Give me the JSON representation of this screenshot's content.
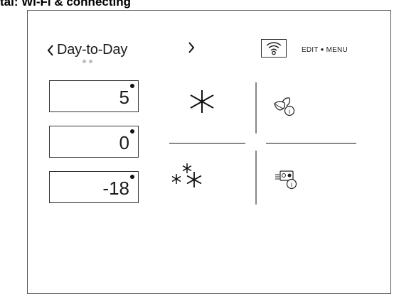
{
  "heading": "tal: Wi-Fi & connecting",
  "nav": {
    "prev_label": "Day-to-Day"
  },
  "header": {
    "edit_label": "EDIT",
    "menu_label": "MENU"
  },
  "temperatures": [
    {
      "value": "5"
    },
    {
      "value": "0"
    },
    {
      "value": "-18"
    }
  ]
}
